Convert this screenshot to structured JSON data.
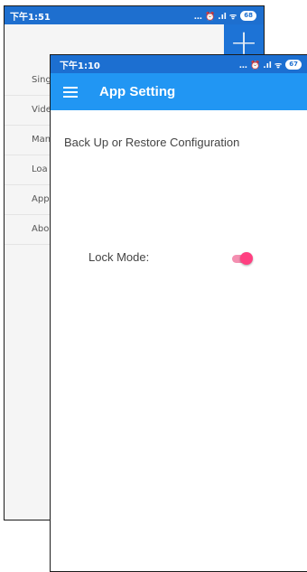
{
  "back_screen": {
    "status_time": "下午1:51",
    "status_icons": "… ⏰ .ıl ᯤ",
    "battery": "68",
    "fab_icon": "plus-icon",
    "menu_items": [
      "Sing",
      "Vide",
      "Man",
      "Loa",
      "App",
      "Abo"
    ]
  },
  "front_screen": {
    "status_time": "下午1:10",
    "status_icons": "… ⏰ .ıl ᯤ",
    "battery": "67",
    "appbar": {
      "menu_icon": "hamburger-menu-icon",
      "title": "App Setting"
    },
    "settings": {
      "backup_label": "Back Up or Restore Configuration",
      "lock_mode_label": "Lock Mode:",
      "lock_mode_enabled": true
    }
  },
  "colors": {
    "status_bar": "#1c6fd1",
    "app_bar": "#2196f3",
    "toggle_on": "#ff4081"
  }
}
